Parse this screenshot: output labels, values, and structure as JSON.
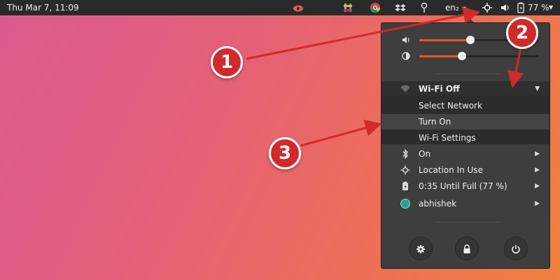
{
  "topbar": {
    "clock": "Thu Mar  7, 11:09",
    "language": "en₂",
    "battery_percent": "77 %",
    "icons": [
      "cloud-icon",
      "slack-icon",
      "chrome-icon",
      "dropbox-icon",
      "pin-icon",
      "location-icon",
      "volume-icon",
      "battery-icon"
    ]
  },
  "menu": {
    "volume_level": 0.43,
    "brightness_level": 0.36,
    "wifi": {
      "title": "Wi-Fi Off",
      "items": [
        "Select Network",
        "Turn On",
        "Wi-Fi Settings"
      ]
    },
    "bluetooth_label": "On",
    "location_label": "Location In Use",
    "battery_label": "0:35 Until Full (77 %)",
    "user_label": "abhishek"
  },
  "callouts": [
    "1",
    "2",
    "3"
  ],
  "colors": {
    "accent": "#e95420",
    "panel": "#3e3e3e",
    "topbar": "#2a2a2a",
    "callout": "#d12a2a"
  }
}
